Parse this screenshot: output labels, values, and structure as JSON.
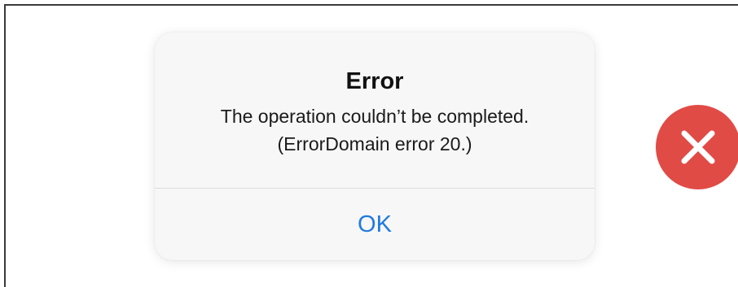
{
  "alert": {
    "title": "Error",
    "message_line1": "The operation couldn’t be completed.",
    "message_line2": "(ErrorDomain error 20.)",
    "button_label": "OK",
    "button_color": "#1f7ae0"
  },
  "badge": {
    "icon": "close-icon",
    "color": "#e14b46"
  }
}
